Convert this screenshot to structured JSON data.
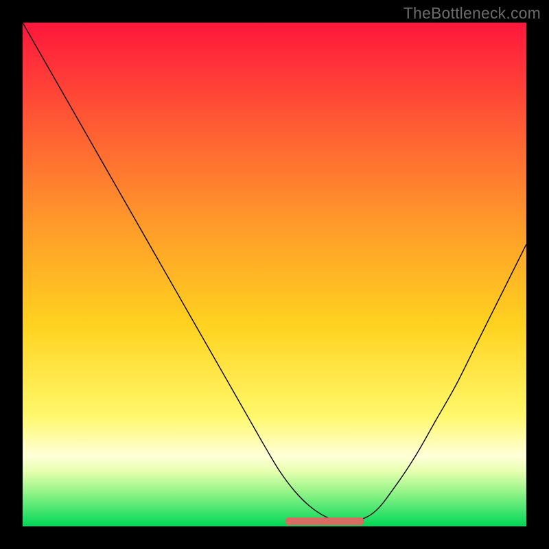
{
  "watermark": "TheBottleneck.com",
  "chart_data": {
    "type": "line",
    "title": "",
    "xlabel": "",
    "ylabel": "",
    "xlim": [
      0,
      100
    ],
    "ylim": [
      0,
      100
    ],
    "grid": false,
    "legend": false,
    "background_gradient": {
      "top_color": "#ff1a3c",
      "mid_color": "#ffd000",
      "low_color": "#ffffa0",
      "bottom_color": "#00e060",
      "stops": [
        {
          "offset": 0.0,
          "color": "#ff163c"
        },
        {
          "offset": 0.2,
          "color": "#ff5a34"
        },
        {
          "offset": 0.4,
          "color": "#ff9a2a"
        },
        {
          "offset": 0.6,
          "color": "#ffd21f"
        },
        {
          "offset": 0.78,
          "color": "#fff86a"
        },
        {
          "offset": 0.86,
          "color": "#ffffd8"
        },
        {
          "offset": 0.89,
          "color": "#e8ffb0"
        },
        {
          "offset": 0.93,
          "color": "#98f58a"
        },
        {
          "offset": 1.0,
          "color": "#00d856"
        }
      ]
    },
    "series": [
      {
        "name": "bottleneck-curve",
        "color": "#000000",
        "width": 1.4,
        "x": [
          0,
          4,
          8,
          12,
          16,
          20,
          24,
          28,
          32,
          36,
          40,
          44,
          48,
          51,
          54,
          57,
          60,
          63,
          66,
          70,
          74,
          78,
          82,
          86,
          90,
          94,
          98,
          100
        ],
        "y": [
          100,
          93,
          86,
          79,
          72,
          65,
          58,
          51,
          44,
          37,
          30,
          23,
          16,
          11,
          7,
          4,
          2,
          1,
          1,
          3,
          8,
          14,
          21,
          28,
          36,
          44,
          52,
          56
        ]
      }
    ],
    "marker_band": {
      "name": "optimal-range",
      "color": "#d86b63",
      "y": 1,
      "x_start": 53,
      "x_end": 67,
      "thickness": 11,
      "end_radius": 6
    }
  }
}
